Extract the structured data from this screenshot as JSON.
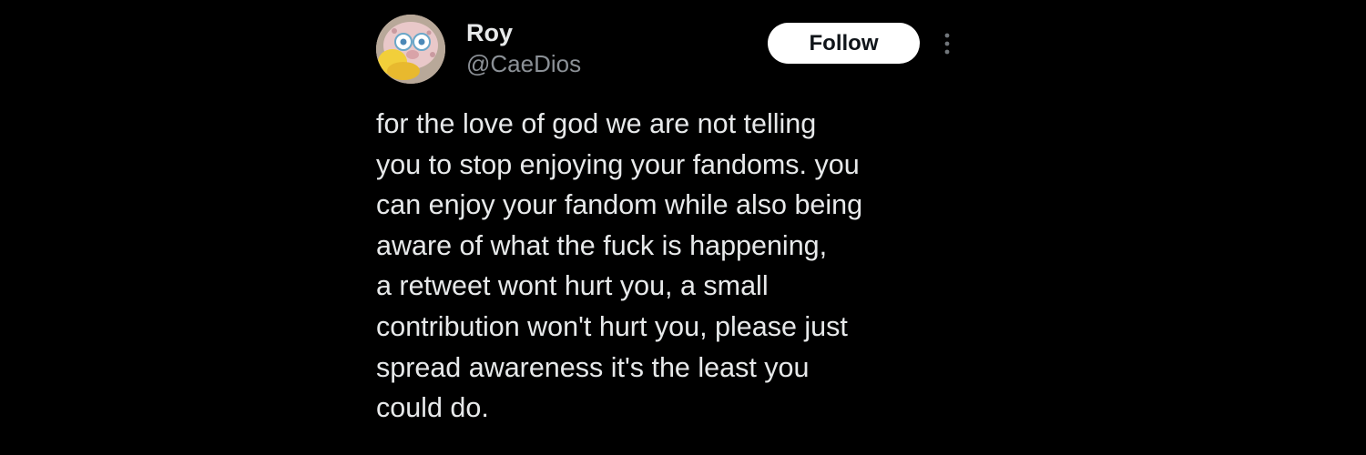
{
  "author": {
    "name": "Roy",
    "handle": "@CaeDios",
    "avatar_icon": "spongebob-plush-avatar"
  },
  "actions": {
    "follow_label": "Follow",
    "more_icon": "more-vertical-icon"
  },
  "post": {
    "lines": [
      "for the love of god we are not telling",
      "you to stop enjoying your fandoms. you",
      "can enjoy your fandom while also being",
      "aware of what the fuck is happening,",
      "a retweet wont hurt you, a small",
      "contribution won't hurt you, please just",
      "spread awareness it's the least you",
      "could do."
    ]
  },
  "colors": {
    "background": "#000000",
    "primary_text": "#e7e9ea",
    "secondary_text": "#8b9096",
    "follow_button_bg": "#ffffff",
    "follow_button_text": "#0f1419"
  }
}
